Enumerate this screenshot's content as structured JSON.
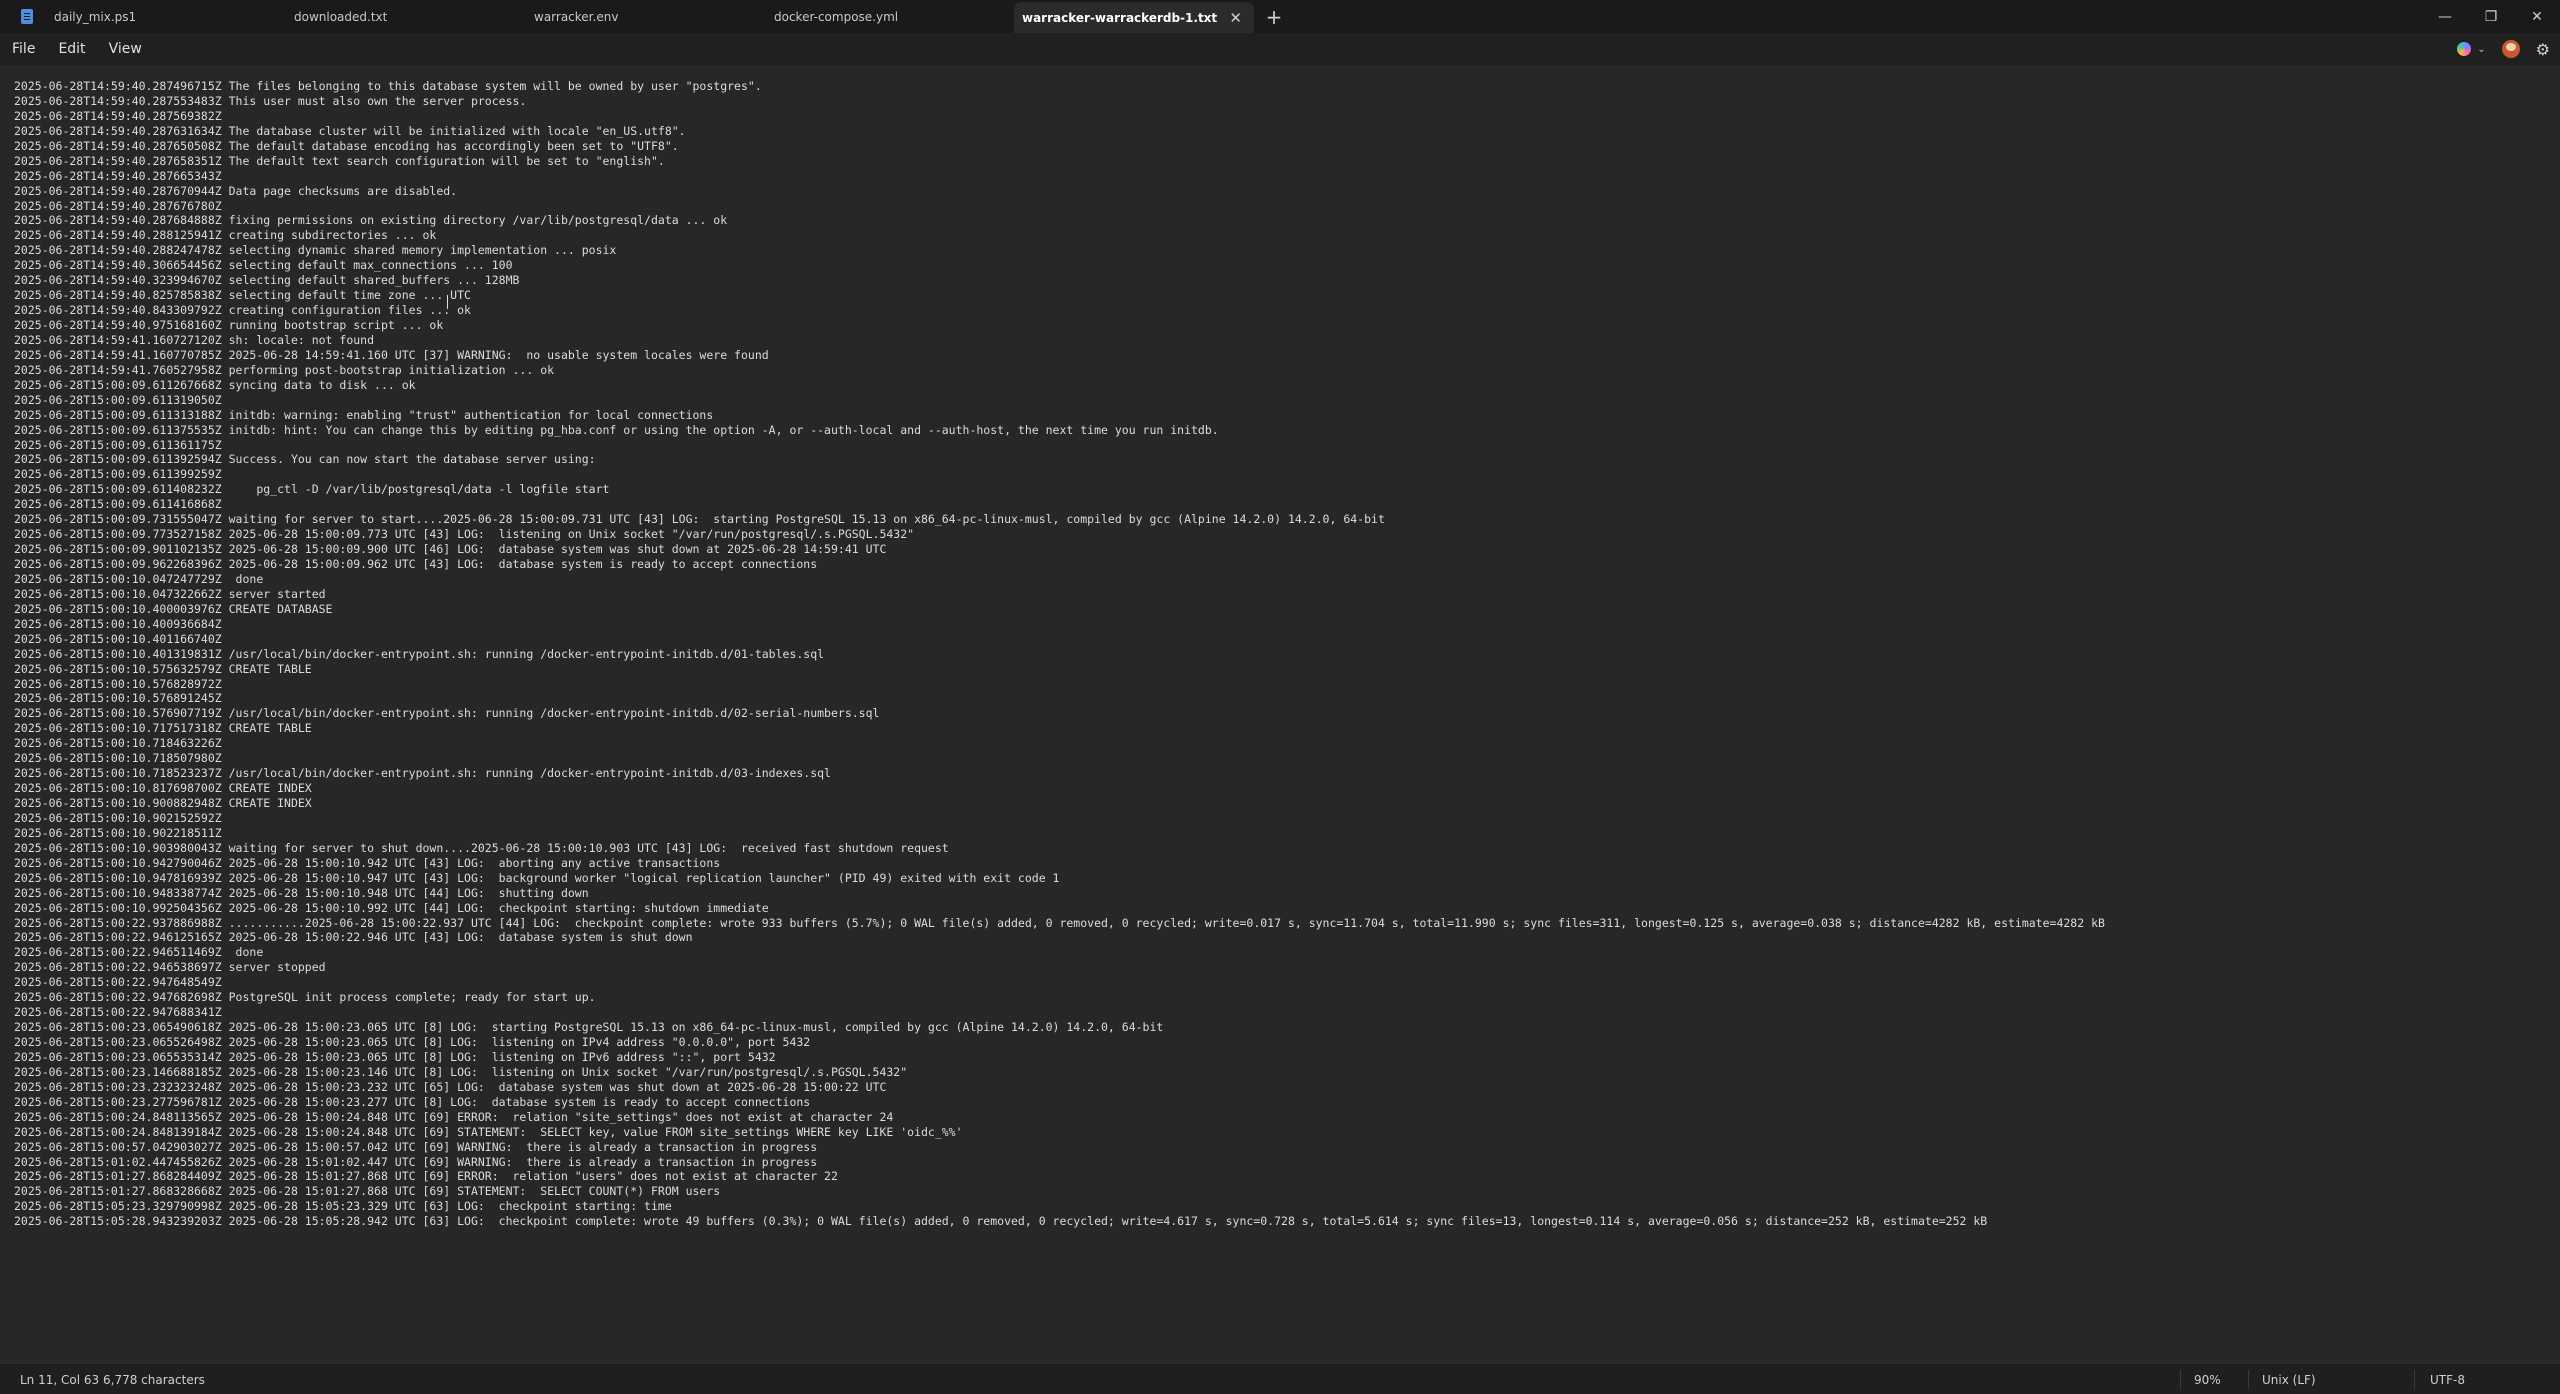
{
  "tabs": [
    {
      "label": "daily_mix.ps1",
      "active": false
    },
    {
      "label": "downloaded.txt",
      "active": false
    },
    {
      "label": "warracker.env",
      "active": false
    },
    {
      "label": "docker-compose.yml",
      "active": false
    },
    {
      "label": "warracker-warrackerdb-1.txt",
      "active": true
    }
  ],
  "menu": {
    "file": "File",
    "edit": "Edit",
    "view": "View"
  },
  "icons": {
    "app": "notepad-icon",
    "close_tab": "close-icon",
    "new_tab": "plus-icon",
    "minimize": "minimize-icon",
    "maximize": "restore-icon",
    "close_window": "close-icon",
    "copilot": "copilot-icon",
    "account": "avatar-icon",
    "settings": "gear-icon"
  },
  "status": {
    "position": "Ln 11, Col 63",
    "characters": "6,778 characters",
    "zoom": "90%",
    "line_ending": "Unix (LF)",
    "encoding": "UTF-8"
  },
  "lines": [
    "2025-06-28T14:59:40.287496715Z The files belonging to this database system will be owned by user \"postgres\".",
    "2025-06-28T14:59:40.287553483Z This user must also own the server process.",
    "2025-06-28T14:59:40.287569382Z",
    "2025-06-28T14:59:40.287631634Z The database cluster will be initialized with locale \"en_US.utf8\".",
    "2025-06-28T14:59:40.287650508Z The default database encoding has accordingly been set to \"UTF8\".",
    "2025-06-28T14:59:40.287658351Z The default text search configuration will be set to \"english\".",
    "2025-06-28T14:59:40.287665343Z",
    "2025-06-28T14:59:40.287670944Z Data page checksums are disabled.",
    "2025-06-28T14:59:40.287676780Z",
    "2025-06-28T14:59:40.287684888Z fixing permissions on existing directory /var/lib/postgresql/data ... ok",
    "2025-06-28T14:59:40.288125941Z creating subdirectories ... ok",
    "2025-06-28T14:59:40.288247478Z selecting dynamic shared memory implementation ... posix",
    "2025-06-28T14:59:40.306654456Z selecting default max_connections ... 100",
    "2025-06-28T14:59:40.323994670Z selecting default shared_buffers ... 128MB",
    "2025-06-28T14:59:40.825785838Z selecting default time zone ... UTC",
    "2025-06-28T14:59:40.843309792Z creating configuration files ... ok",
    "2025-06-28T14:59:40.975168160Z running bootstrap script ... ok",
    "2025-06-28T14:59:41.160727120Z sh: locale: not found",
    "2025-06-28T14:59:41.160770785Z 2025-06-28 14:59:41.160 UTC [37] WARNING:  no usable system locales were found",
    "2025-06-28T14:59:41.760527958Z performing post-bootstrap initialization ... ok",
    "2025-06-28T15:00:09.611267668Z syncing data to disk ... ok",
    "2025-06-28T15:00:09.611319050Z",
    "2025-06-28T15:00:09.611313188Z initdb: warning: enabling \"trust\" authentication for local connections",
    "2025-06-28T15:00:09.611375535Z initdb: hint: You can change this by editing pg_hba.conf or using the option -A, or --auth-local and --auth-host, the next time you run initdb.",
    "2025-06-28T15:00:09.611361175Z",
    "2025-06-28T15:00:09.611392594Z Success. You can now start the database server using:",
    "2025-06-28T15:00:09.611399259Z",
    "2025-06-28T15:00:09.611408232Z     pg_ctl -D /var/lib/postgresql/data -l logfile start",
    "2025-06-28T15:00:09.611416868Z",
    "2025-06-28T15:00:09.731555047Z waiting for server to start....2025-06-28 15:00:09.731 UTC [43] LOG:  starting PostgreSQL 15.13 on x86_64-pc-linux-musl, compiled by gcc (Alpine 14.2.0) 14.2.0, 64-bit",
    "2025-06-28T15:00:09.773527158Z 2025-06-28 15:00:09.773 UTC [43] LOG:  listening on Unix socket \"/var/run/postgresql/.s.PGSQL.5432\"",
    "2025-06-28T15:00:09.901102135Z 2025-06-28 15:00:09.900 UTC [46] LOG:  database system was shut down at 2025-06-28 14:59:41 UTC",
    "2025-06-28T15:00:09.962268396Z 2025-06-28 15:00:09.962 UTC [43] LOG:  database system is ready to accept connections",
    "2025-06-28T15:00:10.047247729Z  done",
    "2025-06-28T15:00:10.047322662Z server started",
    "2025-06-28T15:00:10.400003976Z CREATE DATABASE",
    "2025-06-28T15:00:10.400936684Z",
    "2025-06-28T15:00:10.401166740Z",
    "2025-06-28T15:00:10.401319831Z /usr/local/bin/docker-entrypoint.sh: running /docker-entrypoint-initdb.d/01-tables.sql",
    "2025-06-28T15:00:10.575632579Z CREATE TABLE",
    "2025-06-28T15:00:10.576828972Z",
    "2025-06-28T15:00:10.576891245Z",
    "2025-06-28T15:00:10.576907719Z /usr/local/bin/docker-entrypoint.sh: running /docker-entrypoint-initdb.d/02-serial-numbers.sql",
    "2025-06-28T15:00:10.717517318Z CREATE TABLE",
    "2025-06-28T15:00:10.718463226Z",
    "2025-06-28T15:00:10.718507980Z",
    "2025-06-28T15:00:10.718523237Z /usr/local/bin/docker-entrypoint.sh: running /docker-entrypoint-initdb.d/03-indexes.sql",
    "2025-06-28T15:00:10.817698700Z CREATE INDEX",
    "2025-06-28T15:00:10.900882948Z CREATE INDEX",
    "2025-06-28T15:00:10.902152592Z",
    "2025-06-28T15:00:10.902218511Z",
    "2025-06-28T15:00:10.903980043Z waiting for server to shut down....2025-06-28 15:00:10.903 UTC [43] LOG:  received fast shutdown request",
    "2025-06-28T15:00:10.942790046Z 2025-06-28 15:00:10.942 UTC [43] LOG:  aborting any active transactions",
    "2025-06-28T15:00:10.947816939Z 2025-06-28 15:00:10.947 UTC [43] LOG:  background worker \"logical replication launcher\" (PID 49) exited with exit code 1",
    "2025-06-28T15:00:10.948338774Z 2025-06-28 15:00:10.948 UTC [44] LOG:  shutting down",
    "2025-06-28T15:00:10.992504356Z 2025-06-28 15:00:10.992 UTC [44] LOG:  checkpoint starting: shutdown immediate",
    "2025-06-28T15:00:22.937886988Z ...........2025-06-28 15:00:22.937 UTC [44] LOG:  checkpoint complete: wrote 933 buffers (5.7%); 0 WAL file(s) added, 0 removed, 0 recycled; write=0.017 s, sync=11.704 s, total=11.990 s; sync files=311, longest=0.125 s, average=0.038 s; distance=4282 kB, estimate=4282 kB",
    "2025-06-28T15:00:22.946125165Z 2025-06-28 15:00:22.946 UTC [43] LOG:  database system is shut down",
    "2025-06-28T15:00:22.946511469Z  done",
    "2025-06-28T15:00:22.946538697Z server stopped",
    "2025-06-28T15:00:22.947648549Z",
    "2025-06-28T15:00:22.947682698Z PostgreSQL init process complete; ready for start up.",
    "2025-06-28T15:00:22.947688341Z",
    "2025-06-28T15:00:23.065490618Z 2025-06-28 15:00:23.065 UTC [8] LOG:  starting PostgreSQL 15.13 on x86_64-pc-linux-musl, compiled by gcc (Alpine 14.2.0) 14.2.0, 64-bit",
    "2025-06-28T15:00:23.065526498Z 2025-06-28 15:00:23.065 UTC [8] LOG:  listening on IPv4 address \"0.0.0.0\", port 5432",
    "2025-06-28T15:00:23.065535314Z 2025-06-28 15:00:23.065 UTC [8] LOG:  listening on IPv6 address \"::\", port 5432",
    "2025-06-28T15:00:23.146688185Z 2025-06-28 15:00:23.146 UTC [8] LOG:  listening on Unix socket \"/var/run/postgresql/.s.PGSQL.5432\"",
    "2025-06-28T15:00:23.232323248Z 2025-06-28 15:00:23.232 UTC [65] LOG:  database system was shut down at 2025-06-28 15:00:22 UTC",
    "2025-06-28T15:00:23.277596781Z 2025-06-28 15:00:23.277 UTC [8] LOG:  database system is ready to accept connections",
    "2025-06-28T15:00:24.848113565Z 2025-06-28 15:00:24.848 UTC [69] ERROR:  relation \"site_settings\" does not exist at character 24",
    "2025-06-28T15:00:24.848139184Z 2025-06-28 15:00:24.848 UTC [69] STATEMENT:  SELECT key, value FROM site_settings WHERE key LIKE 'oidc_%%'",
    "2025-06-28T15:00:57.042903027Z 2025-06-28 15:00:57.042 UTC [69] WARNING:  there is already a transaction in progress",
    "2025-06-28T15:01:02.447455826Z 2025-06-28 15:01:02.447 UTC [69] WARNING:  there is already a transaction in progress",
    "2025-06-28T15:01:27.868284409Z 2025-06-28 15:01:27.868 UTC [69] ERROR:  relation \"users\" does not exist at character 22",
    "2025-06-28T15:01:27.868328668Z 2025-06-28 15:01:27.868 UTC [69] STATEMENT:  SELECT COUNT(*) FROM users",
    "2025-06-28T15:05:23.329790998Z 2025-06-28 15:05:23.329 UTC [63] LOG:  checkpoint starting: time",
    "2025-06-28T15:05:28.943239203Z 2025-06-28 15:05:28.942 UTC [63] LOG:  checkpoint complete: wrote 49 buffers (0.3%); 0 WAL file(s) added, 0 removed, 0 recycled; write=4.617 s, sync=0.728 s, total=5.614 s; sync files=13, longest=0.114 s, average=0.056 s; distance=252 kB, estimate=252 kB"
  ]
}
